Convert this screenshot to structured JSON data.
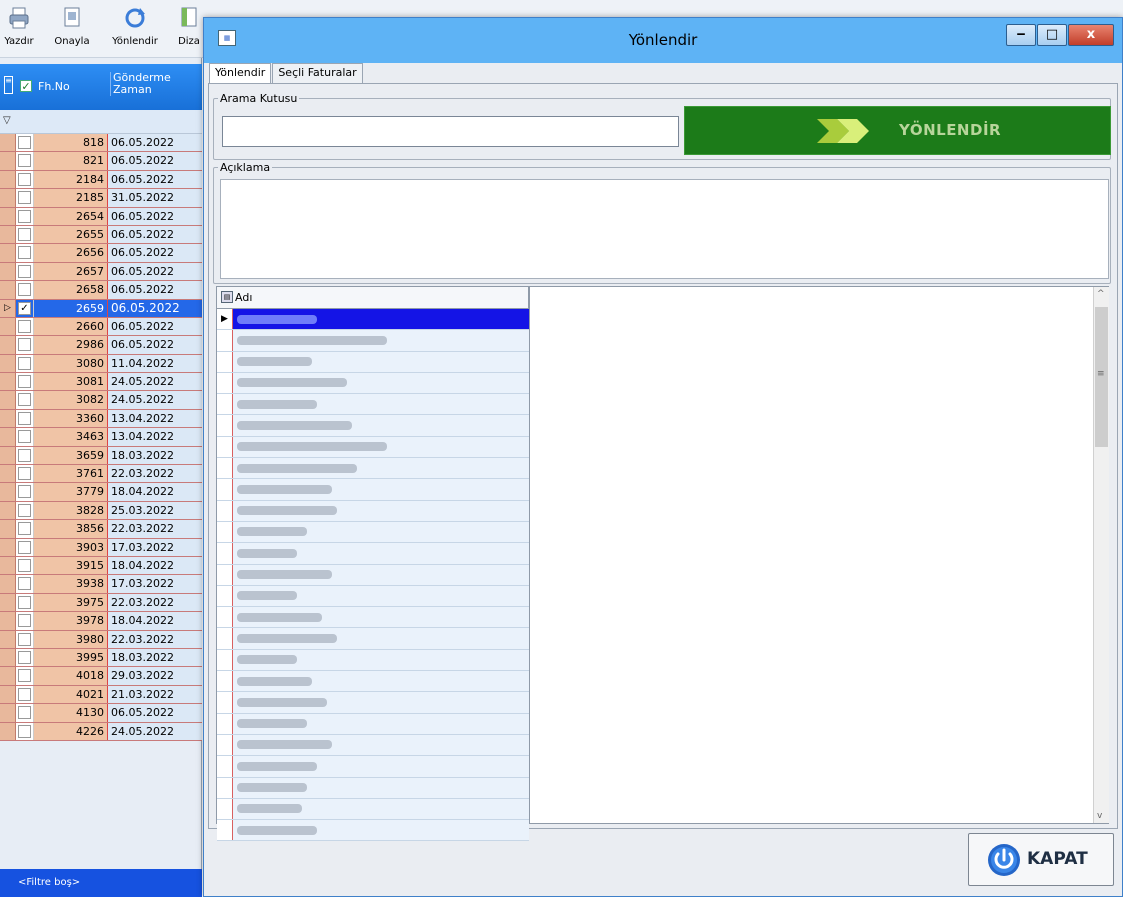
{
  "toolbar": {
    "buttons": [
      {
        "label": "Yazdır"
      },
      {
        "label": "Onayla"
      },
      {
        "label": "Yönlendir"
      },
      {
        "label": "Diza"
      }
    ]
  },
  "left_grid": {
    "headers": {
      "fh_no": "Fh.No",
      "zaman": "Gönderme Zaman"
    },
    "rows": [
      {
        "no": "818",
        "date": "06.05.2022",
        "checked": false
      },
      {
        "no": "821",
        "date": "06.05.2022",
        "checked": false
      },
      {
        "no": "2184",
        "date": "06.05.2022",
        "checked": false
      },
      {
        "no": "2185",
        "date": "31.05.2022",
        "checked": false
      },
      {
        "no": "2654",
        "date": "06.05.2022",
        "checked": false
      },
      {
        "no": "2655",
        "date": "06.05.2022",
        "checked": false
      },
      {
        "no": "2656",
        "date": "06.05.2022",
        "checked": false
      },
      {
        "no": "2657",
        "date": "06.05.2022",
        "checked": false
      },
      {
        "no": "2658",
        "date": "06.05.2022",
        "checked": false
      },
      {
        "no": "2659",
        "date": "06.05.2022",
        "checked": true,
        "selected": true
      },
      {
        "no": "2660",
        "date": "06.05.2022",
        "checked": false
      },
      {
        "no": "2986",
        "date": "06.05.2022",
        "checked": false
      },
      {
        "no": "3080",
        "date": "11.04.2022",
        "checked": false
      },
      {
        "no": "3081",
        "date": "24.05.2022",
        "checked": false
      },
      {
        "no": "3082",
        "date": "24.05.2022",
        "checked": false
      },
      {
        "no": "3360",
        "date": "13.04.2022",
        "checked": false
      },
      {
        "no": "3463",
        "date": "13.04.2022",
        "checked": false
      },
      {
        "no": "3659",
        "date": "18.03.2022",
        "checked": false
      },
      {
        "no": "3761",
        "date": "22.03.2022",
        "checked": false
      },
      {
        "no": "3779",
        "date": "18.04.2022",
        "checked": false
      },
      {
        "no": "3828",
        "date": "25.03.2022",
        "checked": false
      },
      {
        "no": "3856",
        "date": "22.03.2022",
        "checked": false
      },
      {
        "no": "3903",
        "date": "17.03.2022",
        "checked": false
      },
      {
        "no": "3915",
        "date": "18.04.2022",
        "checked": false
      },
      {
        "no": "3938",
        "date": "17.03.2022",
        "checked": false
      },
      {
        "no": "3975",
        "date": "22.03.2022",
        "checked": false
      },
      {
        "no": "3978",
        "date": "18.04.2022",
        "checked": false
      },
      {
        "no": "3980",
        "date": "22.03.2022",
        "checked": false
      },
      {
        "no": "3995",
        "date": "18.03.2022",
        "checked": false
      },
      {
        "no": "4018",
        "date": "29.03.2022",
        "checked": false
      },
      {
        "no": "4021",
        "date": "21.03.2022",
        "checked": false
      },
      {
        "no": "4130",
        "date": "06.05.2022",
        "checked": false
      },
      {
        "no": "4226",
        "date": "24.05.2022",
        "checked": false
      }
    ],
    "filter_status": "<Filtre boş>"
  },
  "dialog": {
    "title": "Yönlendir",
    "tabs": [
      {
        "label": "Yönlendir",
        "active": true
      },
      {
        "label": "Seçli Faturalar",
        "active": false
      }
    ],
    "search_group_label": "Arama Kutusu",
    "search_value": "",
    "yonlendir_label": "YÖNLENDİR",
    "description_group_label": "Açıklama",
    "description_value": "",
    "name_column": "Adı",
    "name_rows_count_note": "names are blurred in the screenshot",
    "close_label": "KAPAT"
  },
  "colors": {
    "accent_blue": "#1652e0",
    "title_bar": "#5eb3f5",
    "go_button": "#1c7b19",
    "close_red": "#c23e2a"
  }
}
